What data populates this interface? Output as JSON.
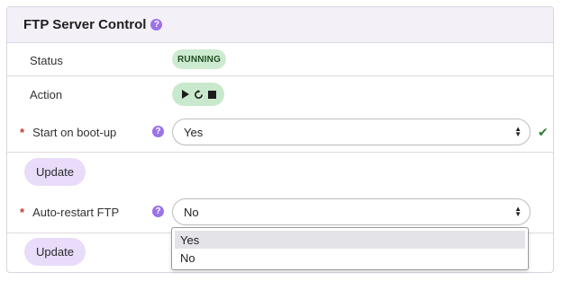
{
  "panel": {
    "title": "FTP Server Control",
    "help_icon": "?"
  },
  "status": {
    "label": "Status",
    "badge": "RUNNING",
    "badge_color": "#cdebd0"
  },
  "action": {
    "label": "Action",
    "icons": [
      "play-icon",
      "restart-icon",
      "stop-icon"
    ]
  },
  "start_on_boot": {
    "required_mark": "*",
    "label": "Start on boot-up",
    "value": "Yes",
    "valid_icon": "✔",
    "update_label": "Update"
  },
  "auto_restart": {
    "required_mark": "*",
    "label": "Auto-restart FTP",
    "value": "No",
    "options": [
      "Yes",
      "No"
    ],
    "highlighted_option": "Yes",
    "update_label": "Update"
  },
  "colors": {
    "accent": "#9b72e8",
    "button_bg": "#e8dcfa",
    "header_bg": "#f4f0f8",
    "valid": "#2e7d32"
  }
}
